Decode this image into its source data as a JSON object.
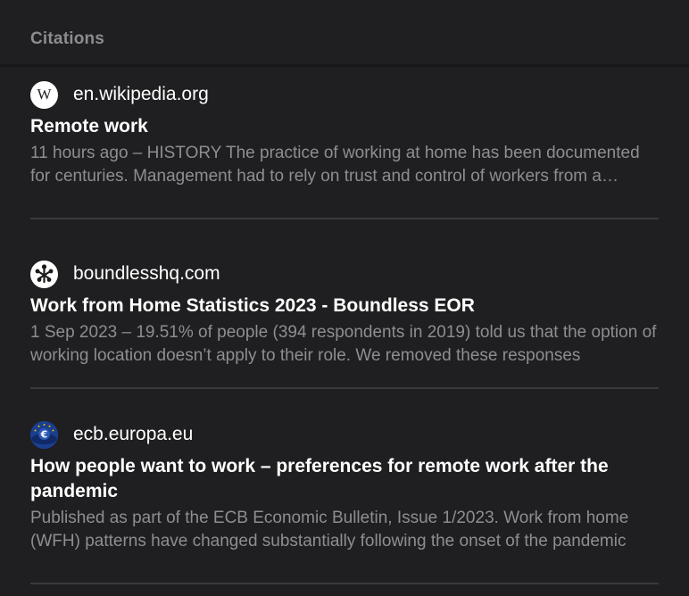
{
  "header": {
    "title": "Citations"
  },
  "citations": [
    {
      "icon": "wikipedia-w-icon",
      "icon_glyph": "W",
      "domain": "en.wikipedia.org",
      "title": "Remote work",
      "snippet": "11 hours ago – HISTORY  The practice of working at home has been documented for centuries. Management had to rely on trust and control of workers from a distance"
    },
    {
      "icon": "boundless-logo-icon",
      "domain": "boundlesshq.com",
      "title": "Work from Home Statistics 2023 - Boundless EOR",
      "snippet": "1 Sep 2023 – 19.51% of people (394 respondents in 2019) told us that the option of working location doesn’t apply to their role. We removed these responses"
    },
    {
      "icon": "ecb-euro-icon",
      "domain": "ecb.europa.eu",
      "title": "How people want to work – preferences for remote work after the pandemic",
      "snippet": "Published as part of the ECB Economic Bulletin, Issue 1/2023. Work from home (WFH) patterns have changed substantially following the onset of the pandemic"
    }
  ],
  "colors": {
    "background": "#1f1f21",
    "header_text": "#8c8c90",
    "primary_text": "#ffffff",
    "secondary_text": "#8e8e92",
    "divider": "#3a3a3d"
  }
}
